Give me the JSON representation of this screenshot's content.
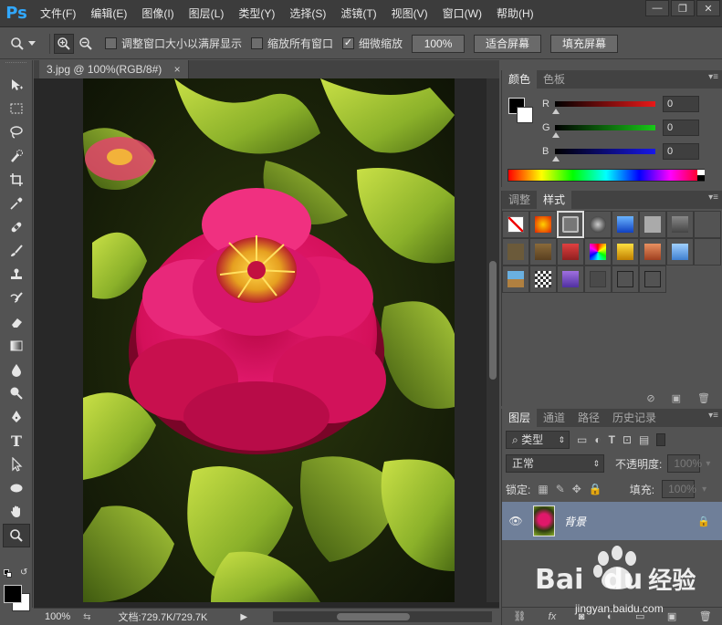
{
  "app": {
    "logo": "Ps"
  },
  "menu": [
    "文件(F)",
    "编辑(E)",
    "图像(I)",
    "图层(L)",
    "类型(Y)",
    "选择(S)",
    "滤镜(T)",
    "视图(V)",
    "窗口(W)",
    "帮助(H)"
  ],
  "window_controls": {
    "minimize": "—",
    "restore": "❐",
    "close": "✕"
  },
  "options": {
    "resize_window": {
      "label": "调整窗口大小以满屏显示",
      "checked": false
    },
    "zoom_all": {
      "label": "缩放所有窗口",
      "checked": false
    },
    "scrubby": {
      "label": "细微缩放",
      "checked": true,
      "mark": "✓"
    },
    "zoom_pct": "100%",
    "fit_screen": "适合屏幕",
    "fill_screen": "填充屏幕"
  },
  "document": {
    "tab_title": "3.jpg @ 100%(RGB/8#)",
    "status_zoom": "100%",
    "status_doc": "文档:729.7K/729.7K"
  },
  "color_panel": {
    "tabs": [
      "颜色",
      "色板"
    ],
    "channels": [
      {
        "letter": "R",
        "value": "0",
        "color": "#e81818"
      },
      {
        "letter": "G",
        "value": "0",
        "color": "#18c818"
      },
      {
        "letter": "B",
        "value": "0",
        "color": "#1818e8"
      }
    ]
  },
  "styles_panel": {
    "tabs": [
      "调整",
      "样式"
    ]
  },
  "layers_panel": {
    "tabs": [
      "图层",
      "通道",
      "路径",
      "历史记录"
    ],
    "filter_kind": "类型",
    "blend_mode": "正常",
    "opacity_label": "不透明度:",
    "opacity_value": "100%",
    "lock_label": "锁定:",
    "fill_label": "填充:",
    "fill_value": "100%",
    "layer_name": "背景"
  },
  "watermark": {
    "brand": "Bai",
    "brand2": "du",
    "cn": "经验",
    "url": "jingyan.baidu.com"
  }
}
